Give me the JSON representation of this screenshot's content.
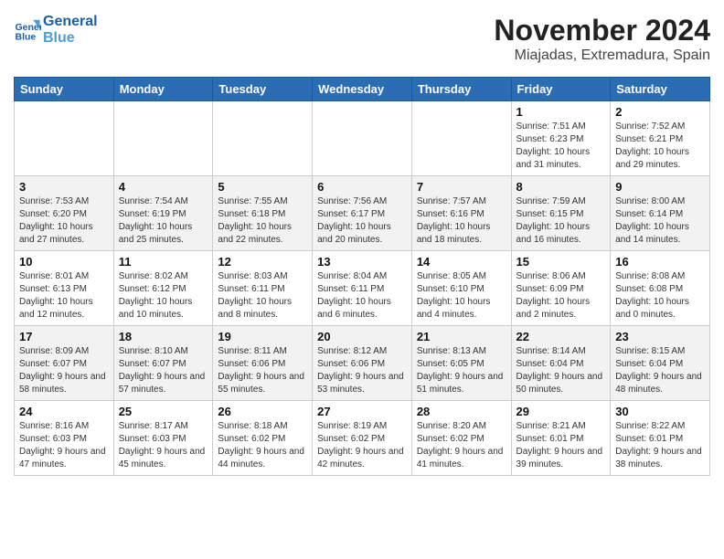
{
  "header": {
    "logo_line1": "General",
    "logo_line2": "Blue",
    "month_year": "November 2024",
    "location": "Miajadas, Extremadura, Spain"
  },
  "weekdays": [
    "Sunday",
    "Monday",
    "Tuesday",
    "Wednesday",
    "Thursday",
    "Friday",
    "Saturday"
  ],
  "weeks": [
    [
      {
        "day": "",
        "info": ""
      },
      {
        "day": "",
        "info": ""
      },
      {
        "day": "",
        "info": ""
      },
      {
        "day": "",
        "info": ""
      },
      {
        "day": "",
        "info": ""
      },
      {
        "day": "1",
        "info": "Sunrise: 7:51 AM\nSunset: 6:23 PM\nDaylight: 10 hours and 31 minutes."
      },
      {
        "day": "2",
        "info": "Sunrise: 7:52 AM\nSunset: 6:21 PM\nDaylight: 10 hours and 29 minutes."
      }
    ],
    [
      {
        "day": "3",
        "info": "Sunrise: 7:53 AM\nSunset: 6:20 PM\nDaylight: 10 hours and 27 minutes."
      },
      {
        "day": "4",
        "info": "Sunrise: 7:54 AM\nSunset: 6:19 PM\nDaylight: 10 hours and 25 minutes."
      },
      {
        "day": "5",
        "info": "Sunrise: 7:55 AM\nSunset: 6:18 PM\nDaylight: 10 hours and 22 minutes."
      },
      {
        "day": "6",
        "info": "Sunrise: 7:56 AM\nSunset: 6:17 PM\nDaylight: 10 hours and 20 minutes."
      },
      {
        "day": "7",
        "info": "Sunrise: 7:57 AM\nSunset: 6:16 PM\nDaylight: 10 hours and 18 minutes."
      },
      {
        "day": "8",
        "info": "Sunrise: 7:59 AM\nSunset: 6:15 PM\nDaylight: 10 hours and 16 minutes."
      },
      {
        "day": "9",
        "info": "Sunrise: 8:00 AM\nSunset: 6:14 PM\nDaylight: 10 hours and 14 minutes."
      }
    ],
    [
      {
        "day": "10",
        "info": "Sunrise: 8:01 AM\nSunset: 6:13 PM\nDaylight: 10 hours and 12 minutes."
      },
      {
        "day": "11",
        "info": "Sunrise: 8:02 AM\nSunset: 6:12 PM\nDaylight: 10 hours and 10 minutes."
      },
      {
        "day": "12",
        "info": "Sunrise: 8:03 AM\nSunset: 6:11 PM\nDaylight: 10 hours and 8 minutes."
      },
      {
        "day": "13",
        "info": "Sunrise: 8:04 AM\nSunset: 6:11 PM\nDaylight: 10 hours and 6 minutes."
      },
      {
        "day": "14",
        "info": "Sunrise: 8:05 AM\nSunset: 6:10 PM\nDaylight: 10 hours and 4 minutes."
      },
      {
        "day": "15",
        "info": "Sunrise: 8:06 AM\nSunset: 6:09 PM\nDaylight: 10 hours and 2 minutes."
      },
      {
        "day": "16",
        "info": "Sunrise: 8:08 AM\nSunset: 6:08 PM\nDaylight: 10 hours and 0 minutes."
      }
    ],
    [
      {
        "day": "17",
        "info": "Sunrise: 8:09 AM\nSunset: 6:07 PM\nDaylight: 9 hours and 58 minutes."
      },
      {
        "day": "18",
        "info": "Sunrise: 8:10 AM\nSunset: 6:07 PM\nDaylight: 9 hours and 57 minutes."
      },
      {
        "day": "19",
        "info": "Sunrise: 8:11 AM\nSunset: 6:06 PM\nDaylight: 9 hours and 55 minutes."
      },
      {
        "day": "20",
        "info": "Sunrise: 8:12 AM\nSunset: 6:06 PM\nDaylight: 9 hours and 53 minutes."
      },
      {
        "day": "21",
        "info": "Sunrise: 8:13 AM\nSunset: 6:05 PM\nDaylight: 9 hours and 51 minutes."
      },
      {
        "day": "22",
        "info": "Sunrise: 8:14 AM\nSunset: 6:04 PM\nDaylight: 9 hours and 50 minutes."
      },
      {
        "day": "23",
        "info": "Sunrise: 8:15 AM\nSunset: 6:04 PM\nDaylight: 9 hours and 48 minutes."
      }
    ],
    [
      {
        "day": "24",
        "info": "Sunrise: 8:16 AM\nSunset: 6:03 PM\nDaylight: 9 hours and 47 minutes."
      },
      {
        "day": "25",
        "info": "Sunrise: 8:17 AM\nSunset: 6:03 PM\nDaylight: 9 hours and 45 minutes."
      },
      {
        "day": "26",
        "info": "Sunrise: 8:18 AM\nSunset: 6:02 PM\nDaylight: 9 hours and 44 minutes."
      },
      {
        "day": "27",
        "info": "Sunrise: 8:19 AM\nSunset: 6:02 PM\nDaylight: 9 hours and 42 minutes."
      },
      {
        "day": "28",
        "info": "Sunrise: 8:20 AM\nSunset: 6:02 PM\nDaylight: 9 hours and 41 minutes."
      },
      {
        "day": "29",
        "info": "Sunrise: 8:21 AM\nSunset: 6:01 PM\nDaylight: 9 hours and 39 minutes."
      },
      {
        "day": "30",
        "info": "Sunrise: 8:22 AM\nSunset: 6:01 PM\nDaylight: 9 hours and 38 minutes."
      }
    ]
  ]
}
